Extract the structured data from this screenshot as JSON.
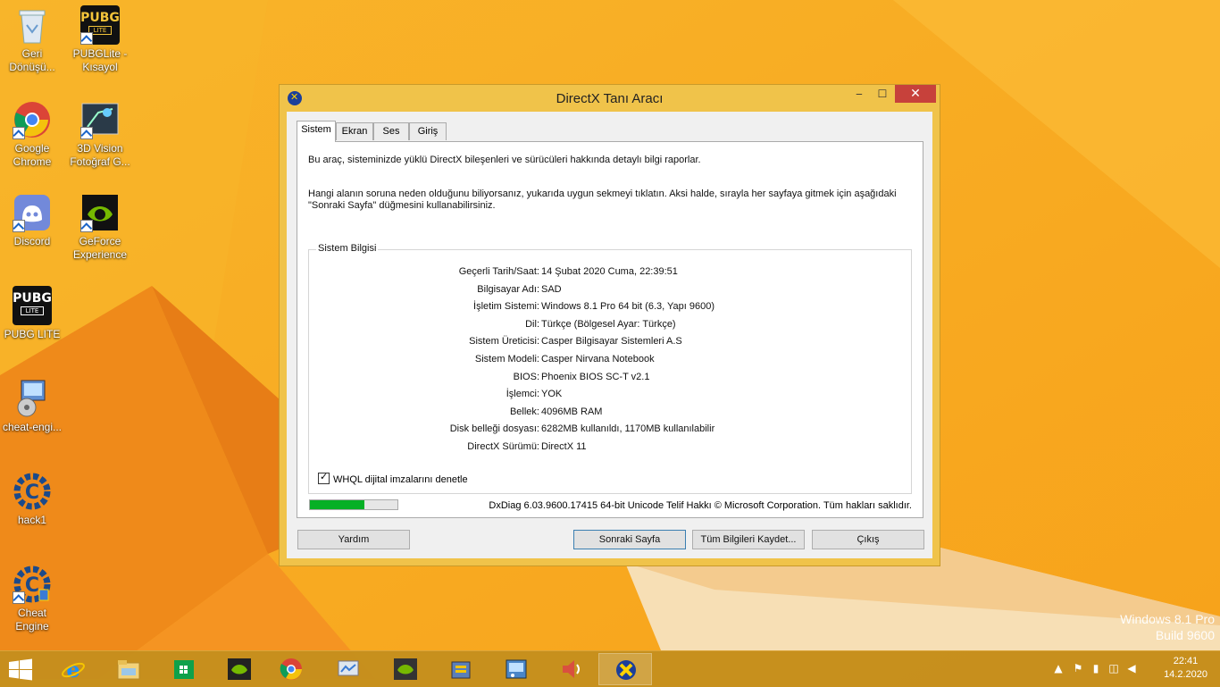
{
  "desktop": {
    "icons": [
      {
        "label": "Geri Dönüşü...",
        "icon": "recycle-bin-icon"
      },
      {
        "label": "PUBGLite - Kısayol",
        "icon": "pubg-lite-icon"
      },
      {
        "label": "Google Chrome",
        "icon": "chrome-icon"
      },
      {
        "label": "3D Vision Fotoğraf G...",
        "icon": "3d-vision-icon"
      },
      {
        "label": "Discord",
        "icon": "discord-icon"
      },
      {
        "label": "GeForce Experience",
        "icon": "geforce-icon"
      },
      {
        "label": "PUBG LITE",
        "icon": "pubg-lite-icon"
      },
      {
        "label": "cheat-engi...",
        "icon": "installer-icon"
      },
      {
        "label": "hack1",
        "icon": "cheat-engine-icon"
      },
      {
        "label": "Cheat Engine",
        "icon": "cheat-engine-icon"
      }
    ],
    "pubg_logo_text": "PUBG",
    "pubg_logo_sub": "LITE",
    "watermark_line1": "Windows 8.1 Pro",
    "watermark_line2": "Build 9600"
  },
  "dialog": {
    "title": "DirectX Tanı Aracı",
    "controls": {
      "minimize": "‒",
      "maximize": "☐",
      "close": "✕"
    },
    "tabs": [
      "Sistem",
      "Ekran",
      "Ses",
      "Giriş"
    ],
    "intro": "Bu araç, sisteminizde yüklü DirectX bileşenleri ve sürücüleri hakkında detaylı bilgi raporlar.",
    "hint_line1": "Hangi alanın soruna neden olduğunu biliyorsanız, yukarıda uygun sekmeyi tıklatın.  Aksi halde, sırayla her sayfaya gitmek için aşağıdaki",
    "hint_line2": "\"Sonraki Sayfa\" düğmesini kullanabilirsiniz.",
    "group_title": "Sistem Bilgisi",
    "info": [
      {
        "key": "Geçerli Tarih/Saat:",
        "value": "14 Şubat 2020 Cuma, 22:39:51"
      },
      {
        "key": "Bilgisayar Adı:",
        "value": "SAD"
      },
      {
        "key": "İşletim Sistemi:",
        "value": "Windows 8.1 Pro 64 bit (6.3, Yapı 9600)"
      },
      {
        "key": "Dil:",
        "value": "Türkçe (Bölgesel Ayar: Türkçe)"
      },
      {
        "key": "Sistem Üreticisi:",
        "value": "Casper Bilgisayar Sistemleri A.S"
      },
      {
        "key": "Sistem Modeli:",
        "value": "Casper Nirvana Notebook"
      },
      {
        "key": "BIOS:",
        "value": "Phoenix BIOS SC-T v2.1"
      },
      {
        "key": "İşlemci:",
        "value": "YOK"
      },
      {
        "key": "Bellek:",
        "value": "4096MB RAM"
      },
      {
        "key": "Disk belleği dosyası:",
        "value": "6282MB kullanıldı, 1170MB kullanılabilir"
      },
      {
        "key": "DirectX Sürümü:",
        "value": "DirectX 11"
      }
    ],
    "whql_label": "WHQL dijital imzalarını denetle",
    "whql_checked": true,
    "progress": 0.62,
    "copyright": "DxDiag 6.03.9600.17415 64-bit Unicode  Telif Hakkı © Microsoft Corporation. Tüm hakları saklıdır.",
    "buttons": {
      "help": "Yardım",
      "next": "Sonraki Sayfa",
      "save": "Tüm Bilgileri Kaydet...",
      "exit": "Çıkış"
    }
  },
  "taskbar": {
    "items": [
      {
        "name": "internet-explorer",
        "running": false
      },
      {
        "name": "file-explorer",
        "running": false
      },
      {
        "name": "store",
        "running": false
      },
      {
        "name": "geforce",
        "running": false
      },
      {
        "name": "chrome",
        "running": false
      },
      {
        "name": "media-app",
        "running": false
      },
      {
        "name": "geforce-experience",
        "running": false
      },
      {
        "name": "archive-app",
        "running": false
      },
      {
        "name": "control-panel",
        "running": false
      },
      {
        "name": "volume-app",
        "running": false
      },
      {
        "name": "directx-diag",
        "running": true
      }
    ],
    "clock_time": "22:41",
    "clock_date": "14.2.2020"
  },
  "colors": {
    "background": "#f4a61c",
    "dialog_frame": "#f0c34a",
    "close_button": "#c7413b",
    "progress_fill": "#06b025"
  }
}
